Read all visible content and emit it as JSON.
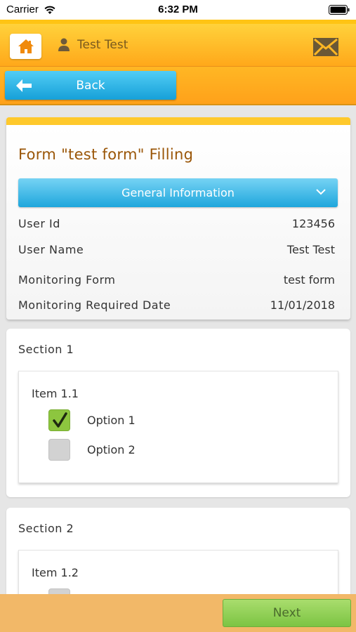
{
  "status_bar": {
    "carrier": "Carrier",
    "time": "6:32 PM"
  },
  "header": {
    "user_name": "Test Test",
    "icons": [
      "home-icon",
      "user-icon",
      "mail-icon"
    ],
    "accent": "#ffa81a"
  },
  "nav": {
    "back_label": "Back"
  },
  "form": {
    "title": "Form \"test form\" Filling",
    "panel_label": "General Information",
    "info_rows": [
      {
        "label": "User Id",
        "value": "123456"
      },
      {
        "label": "User Name",
        "value": "Test Test"
      },
      {
        "label": "Monitoring Form",
        "value": "test form"
      },
      {
        "label": "Monitoring Required Date",
        "value": "11/01/2018"
      }
    ]
  },
  "sections": [
    {
      "title": "Section 1",
      "item": {
        "title": "Item 1.1",
        "options": [
          {
            "label": "Option 1",
            "checked": true
          },
          {
            "label": "Option 2",
            "checked": false
          }
        ]
      }
    },
    {
      "title": "Section 2",
      "item": {
        "title": "Item 1.2"
      }
    }
  ],
  "footer": {
    "next_label": "Next"
  },
  "colors": {
    "checkbox_checked": "#8dc63f",
    "checkbox_unchecked": "#d2d2d2",
    "blue_button": "#1ea6dc",
    "title_text": "#9a5608"
  }
}
